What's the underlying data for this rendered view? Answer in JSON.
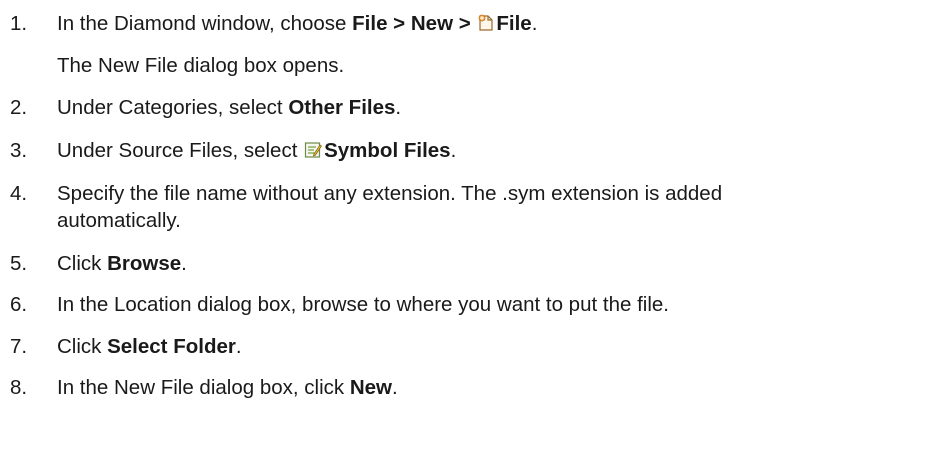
{
  "steps": [
    {
      "num": "1.",
      "pre": "In the Diamond window, choose ",
      "menu_file": "File",
      "sep1": " > ",
      "menu_new": "New",
      "sep2": " > ",
      "icon": "new-file-icon",
      "menu_item": "File",
      "post": ".",
      "note": "The New File dialog box opens."
    },
    {
      "num": "2.",
      "pre": "Under Categories, select ",
      "bold": "Other Files",
      "post": "."
    },
    {
      "num": "3.",
      "pre": "Under Source Files, select ",
      "icon": "symbol-file-icon",
      "bold": "Symbol Files",
      "post": "."
    },
    {
      "num": "4.",
      "line1": "Specify the file name without any extension. The .sym extension is added",
      "line2": "automatically."
    },
    {
      "num": "5.",
      "pre": "Click ",
      "bold": "Browse",
      "post": "."
    },
    {
      "num": "6.",
      "text": "In the Location dialog box, browse to where you want to put the file."
    },
    {
      "num": "7.",
      "pre": "Click ",
      "bold": "Select Folder",
      "post": "."
    },
    {
      "num": "8.",
      "pre": "In the New File dialog box, click ",
      "bold": "New",
      "post": "."
    }
  ]
}
